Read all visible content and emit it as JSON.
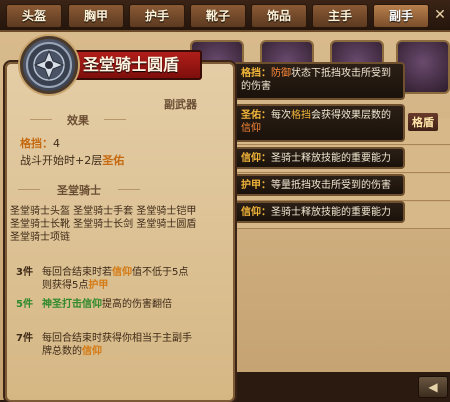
{
  "tabs": [
    {
      "label": "头盔"
    },
    {
      "label": "胸甲"
    },
    {
      "label": "护手"
    },
    {
      "label": "靴子"
    },
    {
      "label": "饰品"
    },
    {
      "label": "主手"
    },
    {
      "label": "副手"
    }
  ],
  "active_tab_index": 6,
  "item": {
    "name": "圣堂骑士圆盾",
    "category": "副武器",
    "effect_header": "效果",
    "block_label": "格挡：",
    "block_value": "4",
    "start_text_1": "战斗开始时+2层",
    "start_keyword": "圣佑"
  },
  "set": {
    "header": "圣堂骑士",
    "items_text_1": "圣堂骑士头盔 圣堂骑士手套 圣堂骑士铠甲",
    "items_text_2": "圣堂骑士长靴 圣堂骑士长剑 圣堂骑士圆盾",
    "items_text_3": "圣堂骑士项链",
    "bonuses": [
      {
        "count": "3件",
        "line1a": "每回合结束时若",
        "line1kw": "信仰",
        "line1b": "值不低于5点",
        "line2a": "则获得5点",
        "line2kw": "护甲"
      },
      {
        "count": "5件",
        "line1kw": "神圣打击信仰",
        "line1b": "提高的伤害翻倍"
      },
      {
        "count": "7件",
        "line1a": "每回合结束时获得你相当于主副手",
        "line2a": "牌总数的",
        "line2kw": "信仰"
      }
    ]
  },
  "tooltips": [
    {
      "key": "格挡：",
      "pre": "",
      "hl": "防御",
      "post": "状态下抵挡攻击所受到的伤害"
    },
    {
      "key": "圣佑：",
      "pre": "每次",
      "hl": "格挡",
      "post": "会获得效果层数的",
      "hl2": "信仰"
    },
    {
      "key": "信仰：",
      "pre": "圣骑士释放技能的重要能力"
    },
    {
      "key": "护甲：",
      "pre": "等量抵挡攻击所受到的伤害"
    },
    {
      "key": "信仰：",
      "pre": "圣骑士释放技能的重要能力"
    }
  ],
  "side_tag": "格盾",
  "close_icon_glyph": "✕",
  "arrow_glyph": "◀"
}
